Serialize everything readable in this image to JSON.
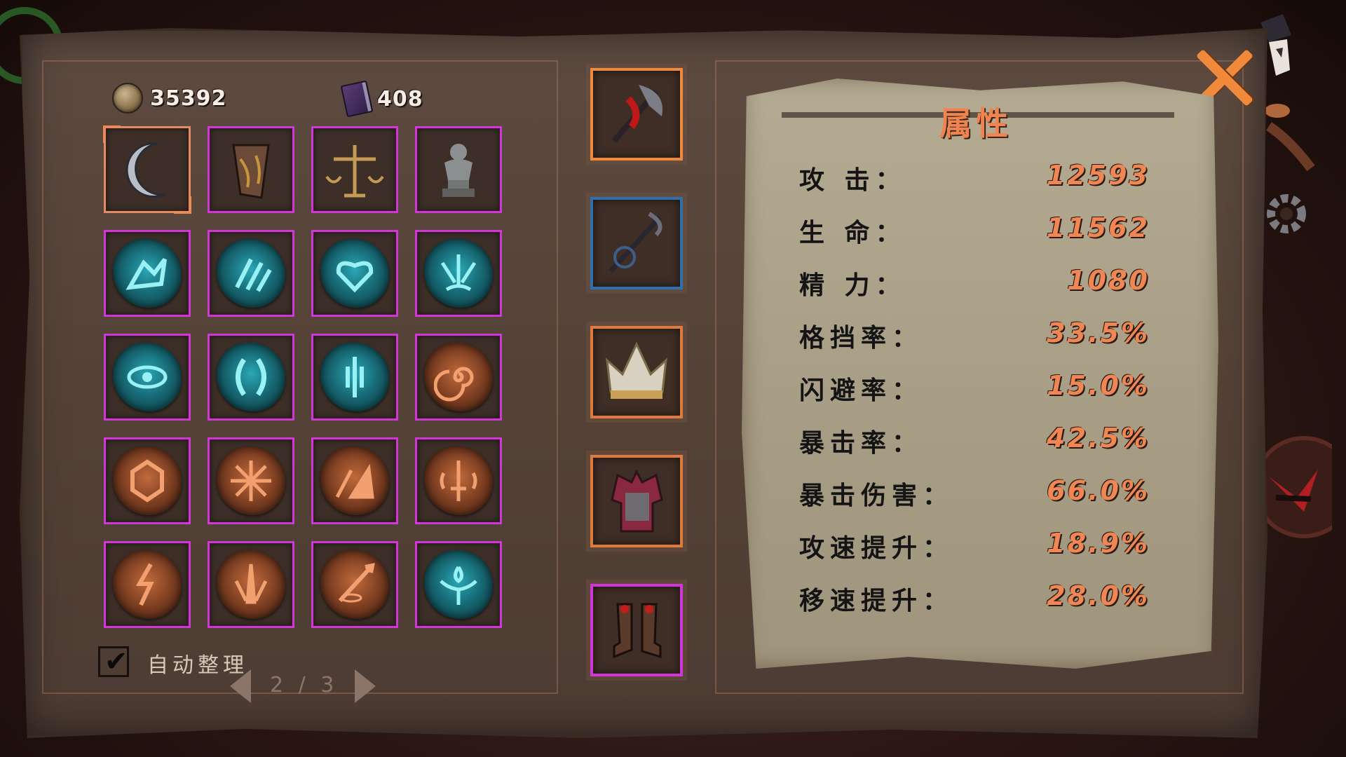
{
  "currencies": [
    {
      "name": "coin-icon",
      "value": "35392"
    },
    {
      "name": "book-icon",
      "value": "408"
    }
  ],
  "inventory": {
    "slots": [
      {
        "type": "item",
        "name": "crescent-moon-icon",
        "selected": true
      },
      {
        "type": "item",
        "name": "bracer-icon"
      },
      {
        "type": "item",
        "name": "scales-icon"
      },
      {
        "type": "item",
        "name": "statue-icon"
      },
      {
        "type": "rune",
        "color": "teal",
        "name": "beast-rune-icon"
      },
      {
        "type": "rune",
        "color": "teal",
        "name": "claw-rune-icon"
      },
      {
        "type": "rune",
        "color": "teal",
        "name": "heart-rune-icon"
      },
      {
        "type": "rune",
        "color": "teal",
        "name": "burst-rune-icon"
      },
      {
        "type": "rune",
        "color": "teal",
        "name": "eye-rune-icon"
      },
      {
        "type": "rune",
        "color": "teal",
        "name": "parenthesis-rune-icon"
      },
      {
        "type": "rune",
        "color": "teal",
        "name": "sword-rune-icon"
      },
      {
        "type": "rune",
        "color": "copper",
        "name": "spiral-rune-icon"
      },
      {
        "type": "rune",
        "color": "copper",
        "name": "shield-rune-icon"
      },
      {
        "type": "rune",
        "color": "copper",
        "name": "star-rune-icon"
      },
      {
        "type": "rune",
        "color": "copper",
        "name": "slash-rune-icon"
      },
      {
        "type": "rune",
        "color": "copper",
        "name": "blade-rune-icon"
      },
      {
        "type": "rune",
        "color": "copper",
        "name": "lightning-rune-icon"
      },
      {
        "type": "rune",
        "color": "copper",
        "name": "spike-rune-icon"
      },
      {
        "type": "rune",
        "color": "copper",
        "name": "spear-rune-icon"
      },
      {
        "type": "rune",
        "color": "teal",
        "name": "drop-rune-icon"
      }
    ],
    "auto_sort_label": "自动整理",
    "auto_sort_checked": true,
    "pager": "2 / 3"
  },
  "equipment": [
    {
      "name": "axe-icon",
      "border": "#f08a3a"
    },
    {
      "name": "anchor-staff-icon",
      "border": "#2f6fae"
    },
    {
      "name": "crown-icon",
      "border": "#e07a3c"
    },
    {
      "name": "armor-icon",
      "border": "#e07a3c"
    },
    {
      "name": "boots-icon",
      "border": "#d236d8"
    }
  ],
  "stats": {
    "title": "属性",
    "rows": [
      {
        "label": "攻 击：",
        "value": "12593"
      },
      {
        "label": "生 命：",
        "value": "11562"
      },
      {
        "label": "精 力：",
        "value": "1080"
      },
      {
        "label": "格挡率：",
        "value": "33.5%"
      },
      {
        "label": "闪避率：",
        "value": "15.0%"
      },
      {
        "label": "暴击率：",
        "value": "42.5%"
      },
      {
        "label": "暴击伤害：",
        "value": "66.0%"
      },
      {
        "label": "攻速提升：",
        "value": "18.9%"
      },
      {
        "label": "移速提升：",
        "value": "28.0%"
      }
    ]
  },
  "colors": {
    "accent": "#f08653",
    "epic_border": "#d236d8",
    "rare_border": "#2f6fae",
    "teal_rune": "#2aa7b4",
    "copper_rune": "#c06a3c"
  }
}
